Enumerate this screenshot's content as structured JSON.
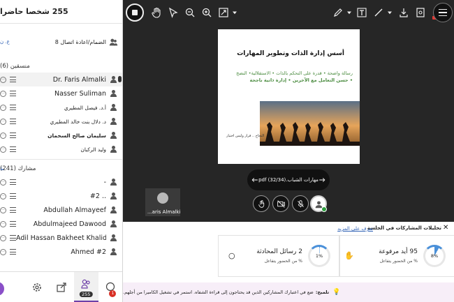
{
  "participants_panel": {
    "header": "255 شخصا حاضرا",
    "reconnect_label": "الضمام/اعادة اتصال 8",
    "reconnect_link": "ع. ن",
    "coordinators_title": "منسقين (6)",
    "coordinators": [
      {
        "name": "Dr. Faris Almalki",
        "lang": "en",
        "bold": false,
        "highlight": true,
        "mic": true
      },
      {
        "name": "Nasser Suliman",
        "lang": "en",
        "bold": false,
        "highlight": false,
        "mic": false
      },
      {
        "name": "أ.د. فيصل المطيري",
        "lang": "ar",
        "bold": false,
        "highlight": false,
        "mic": false
      },
      {
        "name": "د. دلال بنت خالد المطيري",
        "lang": "ar",
        "bold": false,
        "highlight": false,
        "mic": false
      },
      {
        "name": "سليمان صالح السحمان",
        "lang": "ar",
        "bold": true,
        "highlight": false,
        "mic": false
      },
      {
        "name": "وليد الركبان",
        "lang": "ar",
        "bold": false,
        "highlight": false,
        "mic": false
      }
    ],
    "attendees_title": "مشارك (241)",
    "attendees_link": "ط",
    "attendees": [
      {
        "name": "-",
        "lang": "en",
        "bold": false
      },
      {
        "name": "#2 ..",
        "lang": "en",
        "bold": false
      },
      {
        "name": "Abdullah Almayeef",
        "lang": "en",
        "bold": false
      },
      {
        "name": "Abdulmajeed Dawood",
        "lang": "en",
        "bold": false
      },
      {
        "name": "Adil Hassan Bakheet Khalid",
        "lang": "en",
        "bold": false
      },
      {
        "name": "Ahmed #2",
        "lang": "en",
        "bold": false
      }
    ],
    "nav": {
      "participants_count": "255",
      "notifications_count": "1"
    }
  },
  "presentation": {
    "slide": {
      "title": "أسس إدارة الذات وتطوير المهارات",
      "body_line1": "رسالة واضحة  •  قدرة على التحكم بالذات  •  الاستقلالية•  النضج",
      "body_line2": "•  حسن التعامل مع الآخرين  •  إدارة ذاتية ناجحة",
      "caption": "النجاح .. قرار وليس اختيار"
    },
    "file_label": "مهارات الشباب.pdf",
    "page_indicator": "(32/34)",
    "video_name": "...aris Almalki"
  },
  "analytics": {
    "title": "تحليلات المشاركات في الجلسة",
    "learn_more": "تعرف على المزيد",
    "cards": [
      {
        "value_text": "95 أيد مرفوعة",
        "sub_text": "% من الحضور يتفاعل",
        "percent": "8%",
        "percent_value": 8
      },
      {
        "value_text": "2 رسائل المحادثة",
        "sub_text": "% من الحضور يتفاعل",
        "percent": "1%",
        "percent_value": 1
      }
    ]
  },
  "tip": {
    "label": "تلميح:",
    "text": "ضع في اعتبارك المشاركين الذين قد يحتاجون إلى قراءة الشفاه. استمر في تشغيل الكاميرا من أجلهم."
  },
  "colors": {
    "accent": "#6d3fa8",
    "stage_bg": "#262626",
    "slide_green": "#4a8b3f",
    "link_blue": "#3062b5",
    "tip_bg": "#f7eef8"
  }
}
